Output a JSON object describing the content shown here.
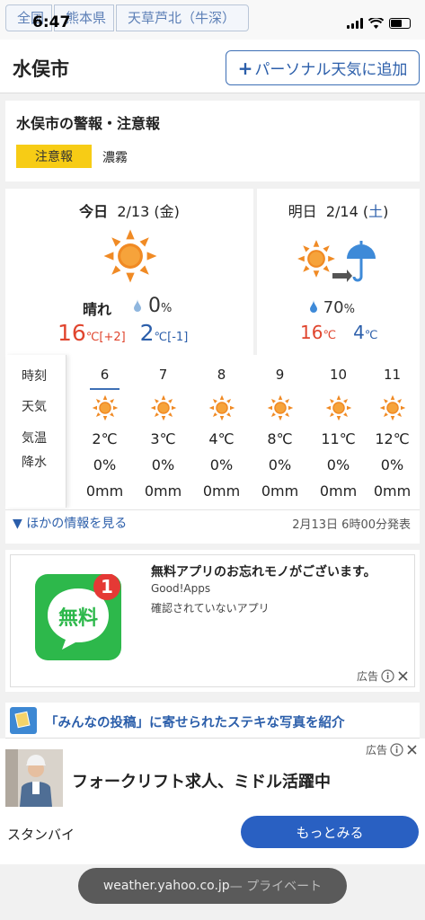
{
  "status_bar": {
    "time": "6:47"
  },
  "breadcrumb": [
    "全国",
    "熊本県",
    "天草芦北（牛深）"
  ],
  "header": {
    "city": "水俣市",
    "add_button_plus": "+",
    "add_button_label": "パーソナル天気に追加"
  },
  "warnings": {
    "title": "水俣市の警報・注意報",
    "badge": "注意報",
    "type": "濃霧"
  },
  "today": {
    "label": "今日",
    "date": "2/13",
    "weekday": "(金)",
    "icon": "sun-icon",
    "condition": "晴れ",
    "precip": "0",
    "precip_unit": "%",
    "high": "16",
    "high_unit": "℃",
    "high_diff": "[+2]",
    "low": "2",
    "low_unit": "℃",
    "low_diff": "[-1]"
  },
  "tomorrow": {
    "label": "明日",
    "date": "2/14",
    "weekday_open": "(",
    "weekday": "土",
    "weekday_close": ")",
    "icon": "sun-then-rain-icon",
    "precip": "70",
    "precip_unit": "%",
    "high": "16",
    "high_unit": "℃",
    "low": "4",
    "low_unit": "℃"
  },
  "hourly": {
    "labels": [
      "時刻",
      "天気",
      "気温",
      "降水"
    ],
    "columns": [
      {
        "time": "6",
        "icon": "sun-icon",
        "temp": "2℃",
        "precip": "0%",
        "amount": "0mm"
      },
      {
        "time": "7",
        "icon": "sun-icon",
        "temp": "3℃",
        "precip": "0%",
        "amount": "0mm"
      },
      {
        "time": "8",
        "icon": "sun-icon",
        "temp": "4℃",
        "precip": "0%",
        "amount": "0mm"
      },
      {
        "time": "9",
        "icon": "sun-icon",
        "temp": "8℃",
        "precip": "0%",
        "amount": "0mm"
      },
      {
        "time": "10",
        "icon": "sun-icon",
        "temp": "11℃",
        "precip": "0%",
        "amount": "0mm"
      },
      {
        "time": "11",
        "icon": "sun-icon",
        "temp": "12℃",
        "precip": "0%",
        "amount": "0mm"
      }
    ],
    "more_link": "▼ ほかの情報を見る",
    "issued": "2月13日 6時00分発表"
  },
  "ad": {
    "logo_text": "無料",
    "notification_count": "1",
    "title": "無料アプリのお忘れモノがございます。",
    "advertiser": "Good!Apps",
    "description": "確認されていないアプリ",
    "label": "広告"
  },
  "promo": {
    "text": "「みんなの投稿」に寄せられたステキな写真を紹介"
  },
  "bottom_ad": {
    "label": "広告",
    "headline": "フォークリフト求人、ミドル活躍中",
    "source": "スタンバイ",
    "cta": "もっとみる"
  },
  "url_bar": {
    "domain": "weather.yahoo.co.jp",
    "mode": " — プライベート"
  },
  "colors": {
    "accent": "#2b5eaa",
    "high": "#e0452e",
    "warning": "#f7cc15",
    "sun": "#f08a24"
  }
}
